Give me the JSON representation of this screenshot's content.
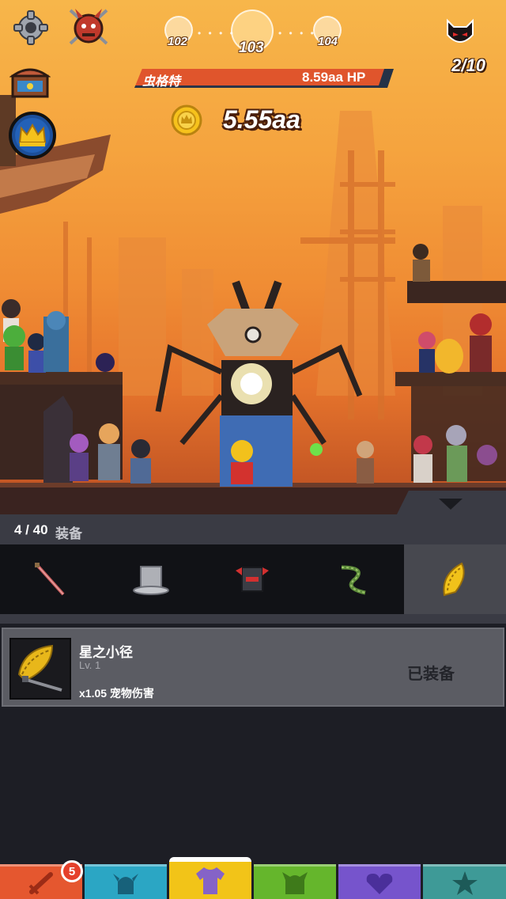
{
  "stage": {
    "previous": "102",
    "current": "103",
    "next": "104",
    "dots_left": "• • • •",
    "dots_right": "• • • •"
  },
  "boss": {
    "name": "虫格特",
    "hp": "8.59aa HP",
    "counter": "2/10"
  },
  "gold": {
    "amount": "5.55aa"
  },
  "equipment": {
    "count": "4 / 40",
    "label": "装备",
    "categories": [
      "sword-icon",
      "top-hat-icon",
      "helmet-icon",
      "serpent-icon",
      "golden-fan-icon"
    ],
    "selected_category": 4
  },
  "item": {
    "name": "星之小径",
    "level": "Lv. 1",
    "effect": "x1.05 宠物伤害",
    "status": "已装备",
    "icon": "golden-fan-weapon-icon"
  },
  "nav": {
    "badge_count": "5",
    "tabs": [
      "sword-icon",
      "viking-helmet-icon",
      "shirt-icon",
      "monster-icon",
      "heart-icon",
      "star-icon"
    ],
    "active_tab": 2
  },
  "colors": {
    "accent": "#f2c418",
    "hp_bar": "#e0552c",
    "panel_bg": "#1d1e25"
  }
}
